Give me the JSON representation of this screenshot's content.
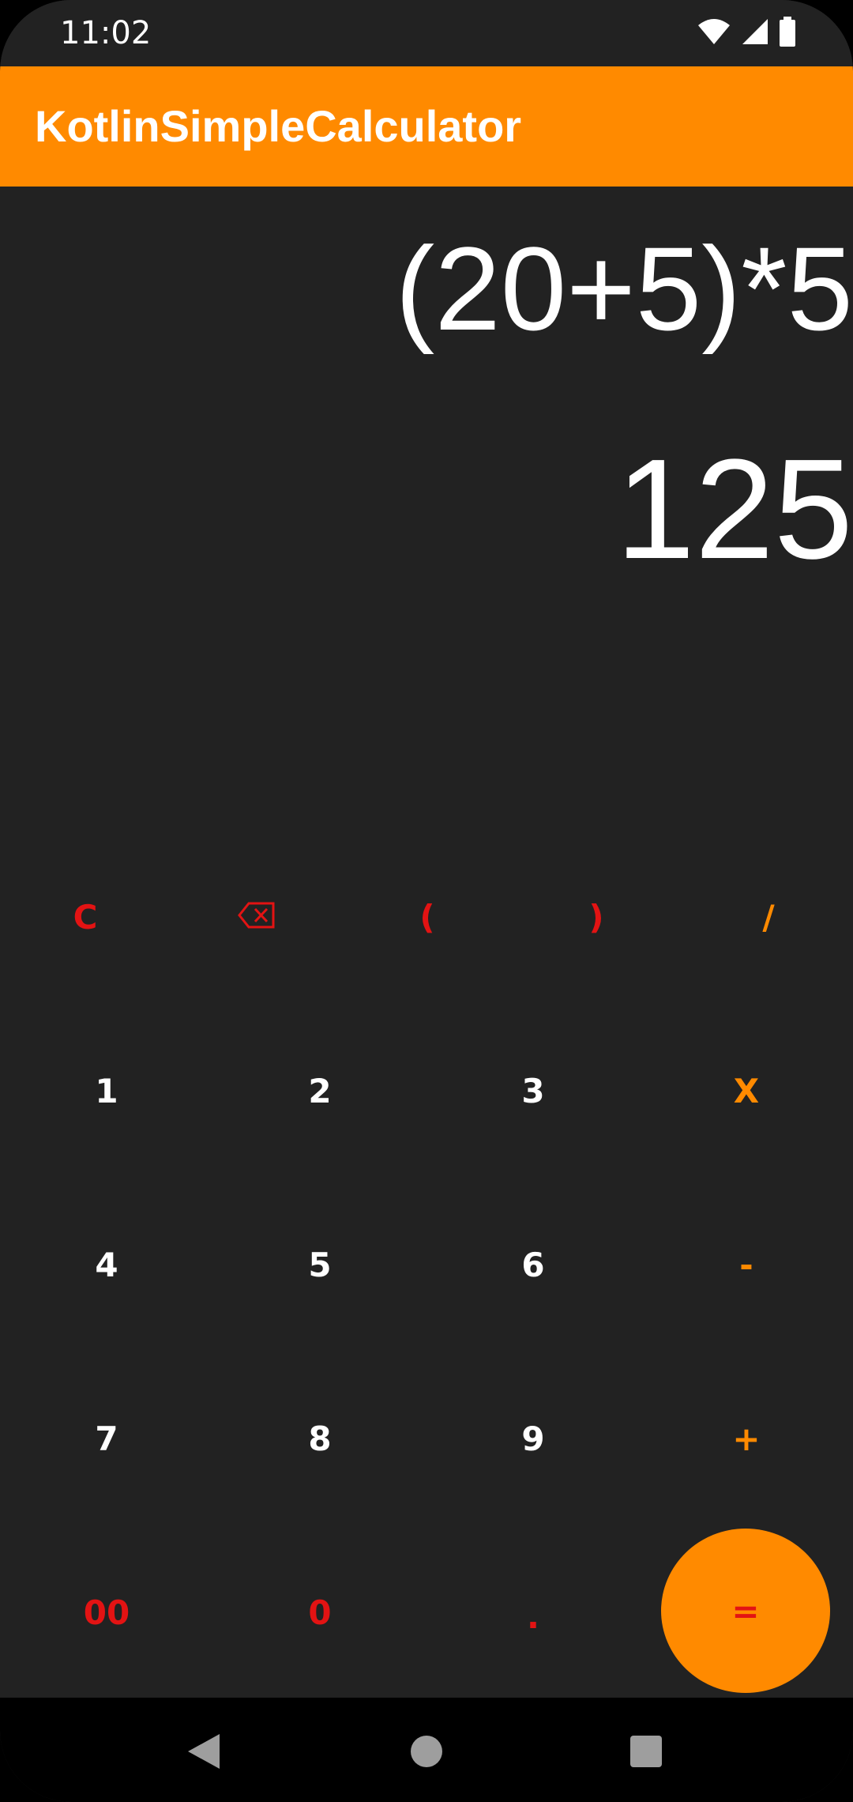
{
  "status_bar": {
    "time": "11:02",
    "icons": [
      "wifi-icon",
      "cellular-signal-icon",
      "battery-icon"
    ]
  },
  "app_bar": {
    "title": "KotlinSimpleCalculator",
    "color": "#FF8A00"
  },
  "display": {
    "expression": "(20+5)*5",
    "result": "125"
  },
  "keypad": {
    "clear": "C",
    "backspace_icon": "backspace-icon",
    "open_paren": "(",
    "close_paren": ")",
    "divide": "/",
    "one": "1",
    "two": "2",
    "three": "3",
    "multiply": "X",
    "four": "4",
    "five": "5",
    "six": "6",
    "minus": "-",
    "seven": "7",
    "eight": "8",
    "nine": "9",
    "plus": "+",
    "double_zero": "00",
    "zero": "0",
    "dot": ".",
    "equals": "="
  },
  "colors": {
    "background": "#222222",
    "accent": "#FF8A00",
    "function_key": "#E31313",
    "digit_key": "#FFFFFF"
  },
  "nav_bar": {
    "icons": [
      "back-icon",
      "home-icon",
      "recents-icon"
    ]
  }
}
